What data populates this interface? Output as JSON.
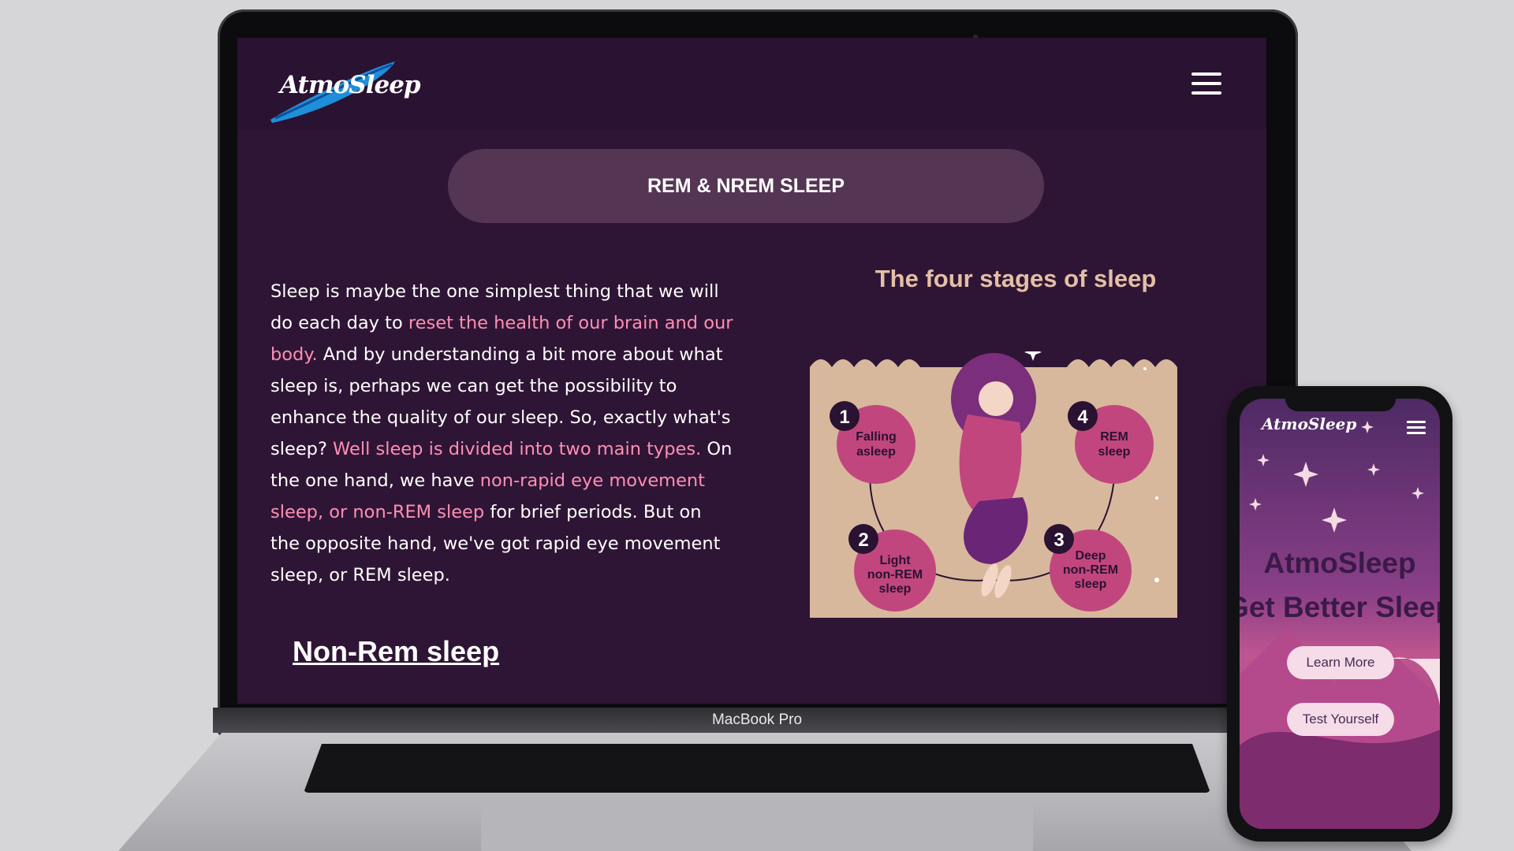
{
  "site": {
    "logo_text": "AtmoSleep",
    "section_pill": "REM & NREM SLEEP",
    "paragraph": [
      {
        "text": "Sleep is maybe the one simplest thing that we will do each day to ",
        "hl": false
      },
      {
        "text": "reset the health of our brain and our body.",
        "hl": true
      },
      {
        "text": " And by understanding a bit more about what sleep is, perhaps we can get the possibility to enhance the quality of our sleep. So, exactly what's sleep? ",
        "hl": false
      },
      {
        "text": "Well sleep is divided into two main types.",
        "hl": true
      },
      {
        "text": " On the one hand, we have ",
        "hl": false
      },
      {
        "text": "non-rapid eye movement sleep, or non-REM sleep",
        "hl": true
      },
      {
        "text": " for brief periods. But on the opposite hand, we've got rapid eye movement sleep, or REM sleep.",
        "hl": false
      }
    ],
    "subheading": "Non-Rem sleep",
    "infographic": {
      "title": "The four stages of sleep",
      "stages": [
        {
          "num": "1",
          "label": [
            "Falling",
            "asleep"
          ]
        },
        {
          "num": "2",
          "label": [
            "Light",
            "non-REM",
            "sleep"
          ]
        },
        {
          "num": "3",
          "label": [
            "Deep",
            "non-REM",
            "sleep"
          ]
        },
        {
          "num": "4",
          "label": [
            "REM",
            "sleep"
          ]
        }
      ]
    }
  },
  "device": {
    "laptop_label": "MacBook Pro"
  },
  "phone": {
    "logo_text": "AtmoSleep",
    "title": "AtmoSleep",
    "subtitle": "Get Better Sleep",
    "buttons": [
      "Learn More",
      "Test Yourself"
    ]
  },
  "colors": {
    "background": "#2f1535",
    "header": "#2a1232",
    "pill": "#553554",
    "highlight": "#ff8fb4",
    "infographic_bg": "#d7b89c",
    "stage_circle": "#c2467e"
  }
}
